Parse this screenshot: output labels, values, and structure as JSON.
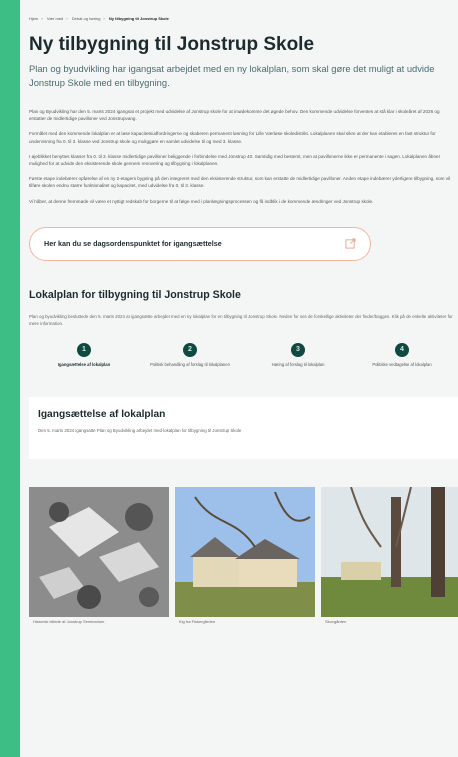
{
  "breadcrumb": [
    "Hjem",
    "Vær med",
    "Debat og høring",
    "Ny tilbygning til Jonstrup Skole"
  ],
  "title": "Ny tilbygning til Jonstrup Skole",
  "lead": "Plan og byudvikling har igangsat arbejdet med en ny lokalplan, som skal gøre det muligt at udvide Jonstrup Skole med en tilbygning.",
  "paragraphs": [
    "Plan og Byudvikling har den 5. marts 2024 igangsat et projekt med udvidelse af Jonstrup skole for at imødekomme det øgede behov. Den kommende udvidelse forventes at stå klar i skoleåret af 2026 og erstatter de midlertidige pavilloner ved Jonstrupvang.",
    "Formålet med den kommende lokalplan er at løse kapacitetsudfordringerne og skaberen permanent løsning for Lille Værløse skoledistrikt. Lokalplanen skal sikre at der kan etableres en fast struktur for undervisning fra 0. til 3. klasse ved Jonstrup skole og muliggøre en samlet udvidelse til og med 3. klasse.",
    "I øjeblikket benyttes klasser fra 0. til 3. klasse midlertidige pavilloner beliggende i forbindelse med Jonstrup 40. Samtidig med bestemt, men at pavillonerne ikke er permanente i sagen. Lokalplanen åbner mulighed for at udvide den eksisterende skole gennem renovering og tilbygning i lokalplanen.",
    "Første etape indebærer opførelse af en ny 2-etagers bygning på den integreret med den eksisterende struktur, som kan erstatte de midlertidige pavilloner. Anden etape indebærer yderligere tilbygning, som vil tilføre skolen endnu større funktionalitet og kapacitet, med udvidelse fra 0. til 3. klasse.",
    "Vi håber, at denne fremmøde vil være et nyttigt redskab for borgerne til at følge med i planlægningsprocessen og få indblik i de kommende ændringer ved Jonstrup skole."
  ],
  "cta": {
    "label": "Her kan du se dagsordenspunktet for igangsættelse",
    "icon": "external-link-icon",
    "border": "#f2b6a0",
    "icon_color": "#e9a48c"
  },
  "section": {
    "title": "Lokalplan for tilbygning til Jonstrup Skole",
    "intro": "Plan og byudvikling besluttede den 5. marts 2024 at igangsætte arbejdet med en ny lokalplan for en tilbygning til Jonstrup Skole. Neden for ses de forskellige aktiviteter der finder/bagges. Klik på de enkelte aktiviteter for mere information."
  },
  "steps": [
    {
      "num": "1",
      "label": "Igangsættelse af lokalplan"
    },
    {
      "num": "2",
      "label": "Politisk behandling af forslag til lokalplanen"
    },
    {
      "num": "3",
      "label": "Høring af forslag til lokalplan"
    },
    {
      "num": "4",
      "label": "Politiske vedtagelse af lokalplan"
    }
  ],
  "panel": {
    "title": "Igangsættelse af lokalplan",
    "text": "Den 5. marts 2024 igangsatte Plan og Byudvikling arbejdet med lokalplan for tilbygning til Jonstrup Skole"
  },
  "photos": [
    {
      "caption": "Historisk billede af Jonstrup Seminarium",
      "kind": "aerial"
    },
    {
      "caption": "Kig fra Fiskergården",
      "kind": "building"
    },
    {
      "caption": "Skovgården",
      "kind": "trees"
    }
  ],
  "colors": {
    "accent_bg": "#3dbe84",
    "step_dot": "#0f4a42"
  }
}
